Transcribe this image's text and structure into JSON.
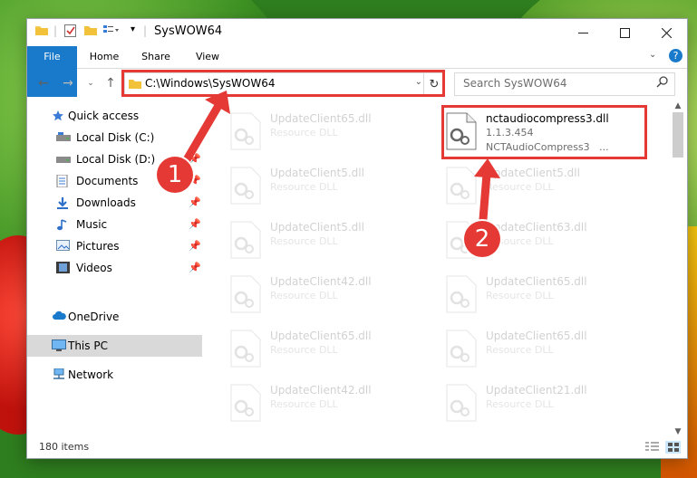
{
  "window": {
    "title": "SysWOW64"
  },
  "ribbon": {
    "tabs": [
      "File",
      "Home",
      "Share",
      "View"
    ]
  },
  "address": {
    "path": "C:\\Windows\\SysWOW64"
  },
  "search": {
    "placeholder": "Search SysWOW64"
  },
  "sidebar": {
    "items": [
      {
        "label": "Quick access",
        "icon": "star-icon"
      },
      {
        "label": "Local Disk (C:)",
        "icon": "drive-icon"
      },
      {
        "label": "Local Disk (D:)",
        "icon": "drive-icon"
      },
      {
        "label": "Documents",
        "icon": "documents-icon"
      },
      {
        "label": "Downloads",
        "icon": "downloads-icon"
      },
      {
        "label": "Music",
        "icon": "music-icon"
      },
      {
        "label": "Pictures",
        "icon": "pictures-icon"
      },
      {
        "label": "Videos",
        "icon": "videos-icon"
      },
      {
        "label": "OneDrive",
        "icon": "cloud-icon"
      },
      {
        "label": "This PC",
        "icon": "computer-icon"
      },
      {
        "label": "Network",
        "icon": "network-icon"
      }
    ]
  },
  "files": {
    "left": [
      {
        "name": "UpdateClient65.dll",
        "type": "Resource DLL"
      },
      {
        "name": "UpdateClient5.dll",
        "type": "Resource DLL"
      },
      {
        "name": "UpdateClient5.dll",
        "type": "Resource DLL"
      },
      {
        "name": "UpdateClient42.dll",
        "type": "Resource DLL"
      },
      {
        "name": "UpdateClient65.dll",
        "type": "Resource DLL"
      },
      {
        "name": "UpdateClient42.dll",
        "type": "Resource DLL"
      }
    ],
    "right": [
      {
        "name": "UpdateClient5.dll",
        "type": "Resource DLL"
      },
      {
        "name": "UpdateClient63.dll",
        "type": "Resource DLL"
      },
      {
        "name": "UpdateClient65.dll",
        "type": "Resource DLL"
      },
      {
        "name": "UpdateClient65.dll",
        "type": "Resource DLL"
      },
      {
        "name": "UpdateClient21.dll",
        "type": "Resource DLL"
      }
    ],
    "highlighted": {
      "name": "nctaudiocompress3.dll",
      "version": "1.1.3.454",
      "description": "NCTAudioCompress3",
      "ellipsis": "..."
    }
  },
  "status": {
    "count": "180 items"
  },
  "markers": [
    "1",
    "2"
  ],
  "colors": {
    "accent": "#1979ca",
    "highlight": "#e53935"
  }
}
